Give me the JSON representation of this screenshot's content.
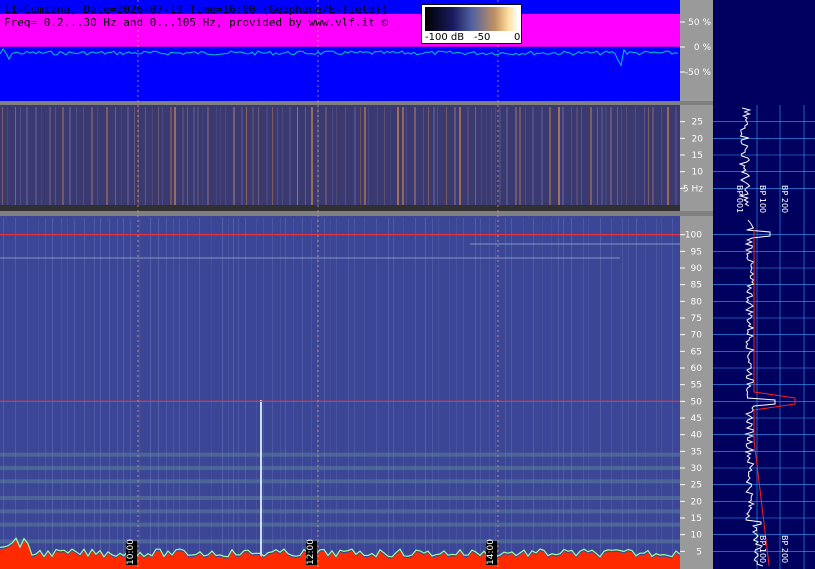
{
  "header": {
    "line1": "I1-Cumiana, Date=2026-07-19 Time=16:00 (Geophone/E-field))",
    "line2": "Freq= 0.2...30 Hz and 0...105 Hz, provided by www.vlf.it ©"
  },
  "legend": {
    "labels": [
      "-100 dB",
      "-50",
      "0"
    ]
  },
  "colors": {
    "amplitude_bg": "#0000ff",
    "amplitude_fill": "#ff00ff",
    "trace": "#00c0c0",
    "spectro_bg": "#3a4a90",
    "low_spectro_bg": "#3c4696",
    "hum_line": "#ff2020",
    "right_panel": "#00005e",
    "grid_light": "#3aa0ff"
  },
  "chart_data": [
    {
      "type": "line",
      "name": "amplitude",
      "ytick_labels": [
        "50 %",
        "0 %",
        "-50 %"
      ],
      "yticks": [
        50,
        0,
        -50
      ],
      "ylim": [
        -100,
        100
      ]
    },
    {
      "type": "heatmap",
      "name": "spectrogram-0.2-30Hz",
      "ytick_labels": [
        "25",
        "20",
        "15",
        "10",
        "5 Hz"
      ],
      "yticks": [
        25,
        20,
        15,
        10,
        5
      ],
      "ylim": [
        0,
        30
      ]
    },
    {
      "type": "heatmap",
      "name": "spectrogram-0-105Hz",
      "ytick_labels": [
        "100",
        "95",
        "90",
        "85",
        "80",
        "75",
        "70",
        "65",
        "60",
        "55",
        "50",
        "45",
        "40",
        "35",
        "30",
        "25",
        "20",
        "15",
        "10",
        "5"
      ],
      "yticks": [
        100,
        95,
        90,
        85,
        80,
        75,
        70,
        65,
        60,
        55,
        50,
        45,
        40,
        35,
        30,
        25,
        20,
        15,
        10,
        5
      ],
      "ylim": [
        0,
        105
      ],
      "time_labels": [
        "10:00",
        "12:00",
        "14:00"
      ],
      "hum_lines_hz": [
        100,
        50
      ]
    },
    {
      "type": "line",
      "name": "spectrum-profile",
      "bp_labels_upper": [
        "BP 001",
        "BP 100",
        "BP 200"
      ],
      "bp_labels_lower": [
        "BP 100",
        "BP 200"
      ]
    }
  ]
}
